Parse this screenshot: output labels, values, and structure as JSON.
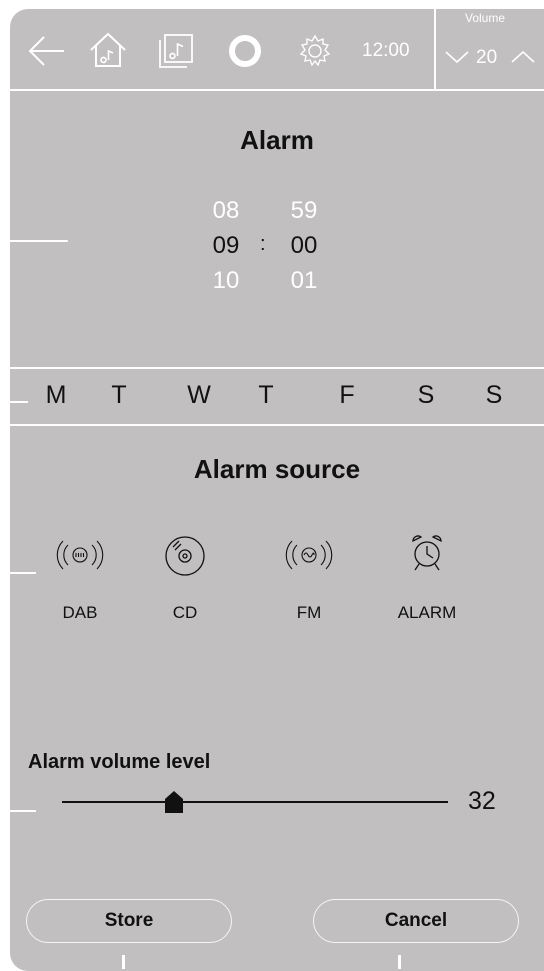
{
  "topbar": {
    "icons": [
      "back-arrow-icon",
      "home-icon",
      "music-note-icon",
      "alexa-ring-icon",
      "settings-gear-icon"
    ],
    "time": "12:00",
    "volume": {
      "label": "Volume",
      "value": "20"
    }
  },
  "alarm": {
    "title": "Alarm",
    "hours": [
      "08",
      "09",
      "10"
    ],
    "minutes": [
      "59",
      "00",
      "01"
    ],
    "separator": ":"
  },
  "days": [
    "M",
    "T",
    "W",
    "T",
    "F",
    "S",
    "S"
  ],
  "source": {
    "title": "Alarm source",
    "items": [
      {
        "label": "DAB",
        "icon": "dab-radio-icon"
      },
      {
        "label": "CD",
        "icon": "cd-disc-icon"
      },
      {
        "label": "FM",
        "icon": "fm-radio-icon"
      },
      {
        "label": "ALARM",
        "icon": "alarm-clock-icon"
      }
    ]
  },
  "volume_level": {
    "title": "Alarm volume level",
    "value": "32",
    "fraction": 0.29
  },
  "buttons": {
    "store": "Store",
    "cancel": "Cancel"
  }
}
